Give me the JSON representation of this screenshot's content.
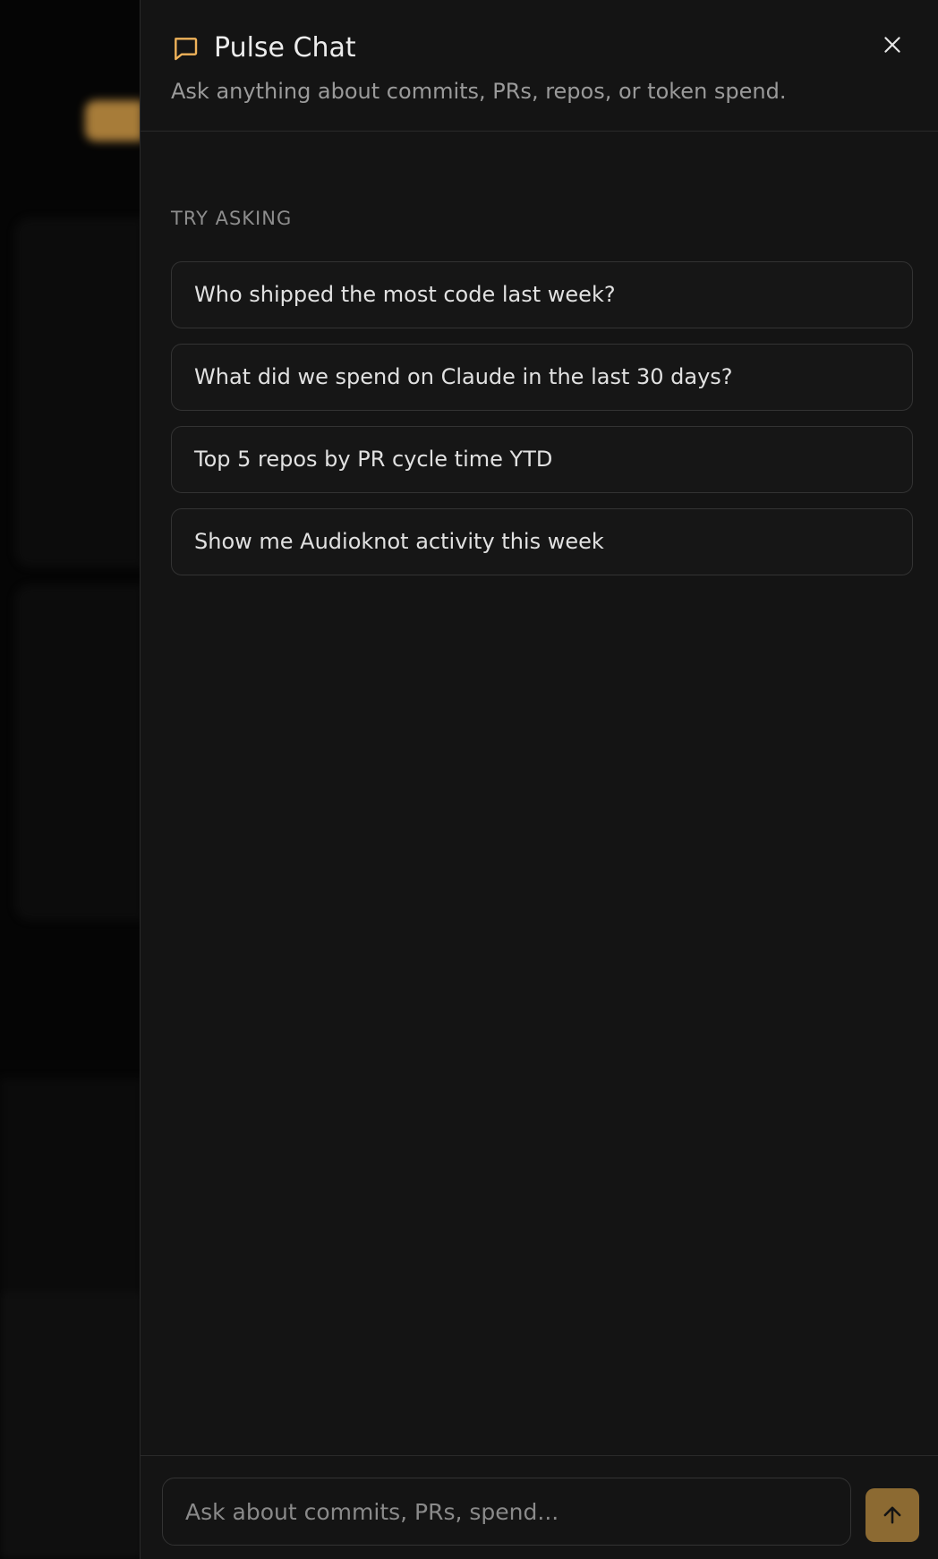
{
  "panel": {
    "title": "Pulse Chat",
    "subtitle": "Ask anything about commits, PRs, repos, or token spend.",
    "close_icon": "close-icon",
    "chat_icon": "chat-bubble-icon"
  },
  "suggestions": {
    "label": "TRY ASKING",
    "items": [
      "Who shipped the most code last week?",
      "What did we spend on Claude in the last 30 days?",
      "Top 5 repos by PR cycle time YTD",
      "Show me Audioknot activity this week"
    ]
  },
  "input": {
    "placeholder": "Ask about commits, PRs, spend...",
    "value": ""
  },
  "send_icon": "arrow-up-icon",
  "colors": {
    "accent": "#f0b35a",
    "panel_bg": "#141414",
    "border": "#333333",
    "send_bg": "#8c6a32"
  }
}
